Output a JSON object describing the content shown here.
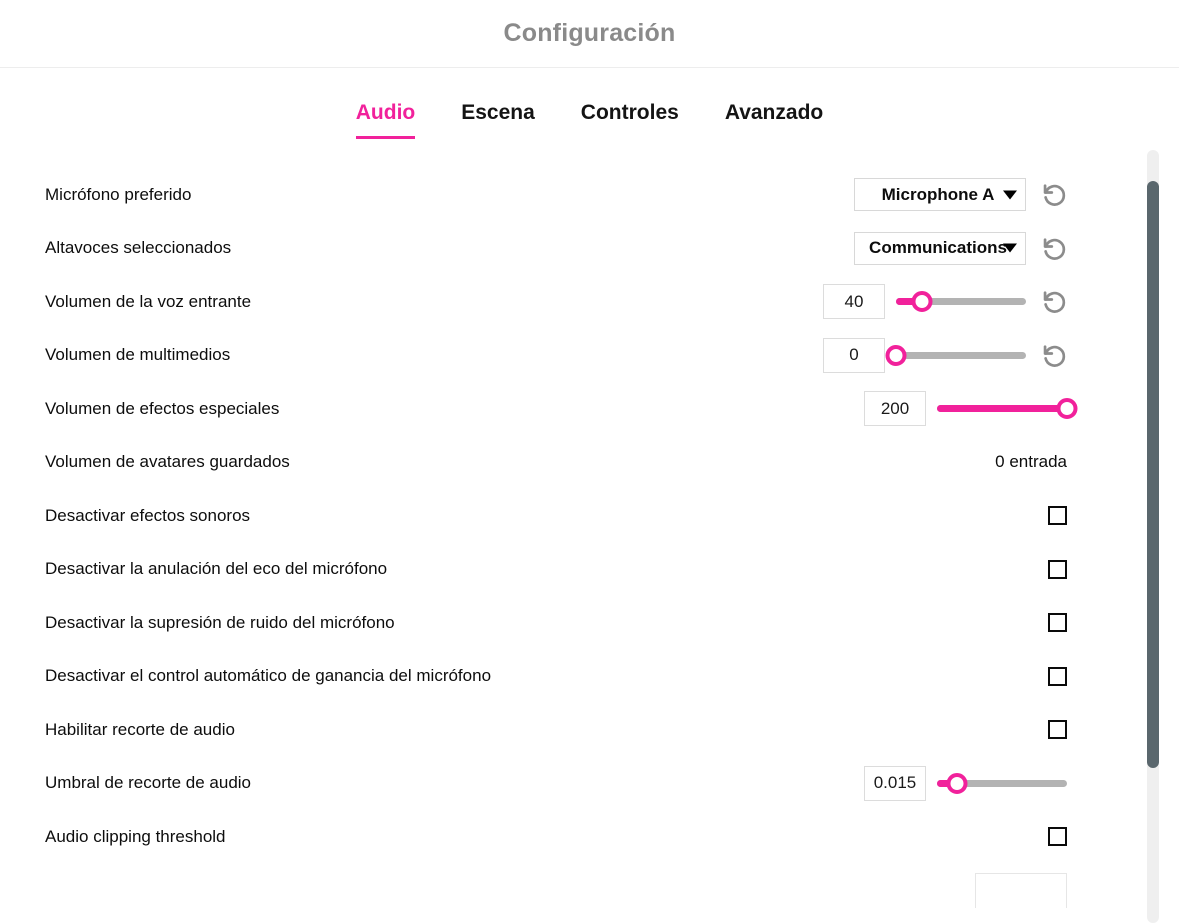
{
  "header": {
    "title": "Configuración"
  },
  "tabs": [
    {
      "label": "Audio",
      "active": true
    },
    {
      "label": "Escena",
      "active": false
    },
    {
      "label": "Controles",
      "active": false
    },
    {
      "label": "Avanzado",
      "active": false
    }
  ],
  "colors": {
    "accent": "#f1219b",
    "title": "#8a8a8a",
    "label": "#0d0d0d",
    "track": "#b3b3b3",
    "scrollbar_thumb": "#5a676d",
    "scrollbar_track": "#efefef"
  },
  "icons": {
    "reset": "reset-arrow-icon",
    "dropdown": "chevron-down-icon"
  },
  "rows": [
    {
      "label": "Micrófono preferido",
      "type": "select",
      "value": "Microphone A",
      "has_reset": true
    },
    {
      "label": "Altavoces seleccionados",
      "type": "select",
      "value": "Communications",
      "has_reset": true
    },
    {
      "label": "Volumen de la voz entrante",
      "type": "slider",
      "value": "40",
      "percent": 20,
      "has_reset": true
    },
    {
      "label": "Volumen de multimedios",
      "type": "slider",
      "value": "0",
      "percent": 0,
      "has_reset": true
    },
    {
      "label": "Volumen de efectos especiales",
      "type": "slider",
      "value": "200",
      "percent": 100,
      "has_reset": false
    },
    {
      "label": "Volumen de avatares guardados",
      "type": "text",
      "value": "0 entrada",
      "has_reset": false
    },
    {
      "label": "Desactivar efectos sonoros",
      "type": "checkbox",
      "checked": false,
      "has_reset": false
    },
    {
      "label": "Desactivar la anulación del eco del micrófono",
      "type": "checkbox",
      "checked": false,
      "has_reset": false
    },
    {
      "label": "Desactivar la supresión de ruido del micrófono",
      "type": "checkbox",
      "checked": false,
      "has_reset": false
    },
    {
      "label": "Desactivar el control automático de ganancia del micrófono",
      "type": "checkbox",
      "checked": false,
      "has_reset": false
    },
    {
      "label": "Habilitar recorte de audio",
      "type": "checkbox",
      "checked": false,
      "has_reset": false
    },
    {
      "label": "Umbral de recorte de audio",
      "type": "slider",
      "value": "0.015",
      "percent": 15,
      "has_reset": false
    },
    {
      "label": "Audio clipping threshold",
      "type": "checkbox",
      "checked": false,
      "has_reset": false
    },
    {
      "label": "",
      "type": "partial",
      "value": "",
      "has_reset": false
    }
  ],
  "scrollbar": {
    "thumb_top_pct": 4,
    "thumb_height_pct": 76
  }
}
